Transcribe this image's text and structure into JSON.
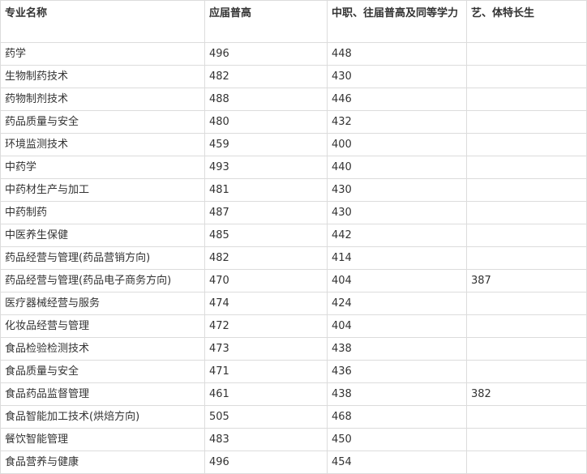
{
  "table": {
    "headers": [
      "专业名称",
      "应届普高",
      "中职、往届普高及同等学力",
      "艺、体特长生"
    ],
    "rows": [
      [
        "药学",
        "496",
        "448",
        ""
      ],
      [
        "生物制药技术",
        "482",
        "430",
        ""
      ],
      [
        "药物制剂技术",
        "488",
        "446",
        ""
      ],
      [
        "药品质量与安全",
        "480",
        "432",
        ""
      ],
      [
        "环境监测技术",
        "459",
        "400",
        ""
      ],
      [
        "中药学",
        "493",
        "440",
        ""
      ],
      [
        "中药材生产与加工",
        "481",
        "430",
        ""
      ],
      [
        "中药制药",
        "487",
        "430",
        ""
      ],
      [
        "中医养生保健",
        "485",
        "442",
        ""
      ],
      [
        "药品经营与管理(药品营销方向)",
        "482",
        "414",
        ""
      ],
      [
        "药品经营与管理(药品电子商务方向)",
        "470",
        "404",
        "387"
      ],
      [
        "医疗器械经营与服务",
        "474",
        "424",
        ""
      ],
      [
        "化妆品经营与管理",
        "472",
        "404",
        ""
      ],
      [
        "食品检验检测技术",
        "473",
        "438",
        ""
      ],
      [
        "食品质量与安全",
        "471",
        "436",
        ""
      ],
      [
        "食品药品监督管理",
        "461",
        "438",
        "382"
      ],
      [
        "食品智能加工技术(烘焙方向)",
        "505",
        "468",
        ""
      ],
      [
        "餐饮智能管理",
        "483",
        "450",
        ""
      ],
      [
        "食品营养与健康",
        "496",
        "454",
        ""
      ]
    ]
  }
}
